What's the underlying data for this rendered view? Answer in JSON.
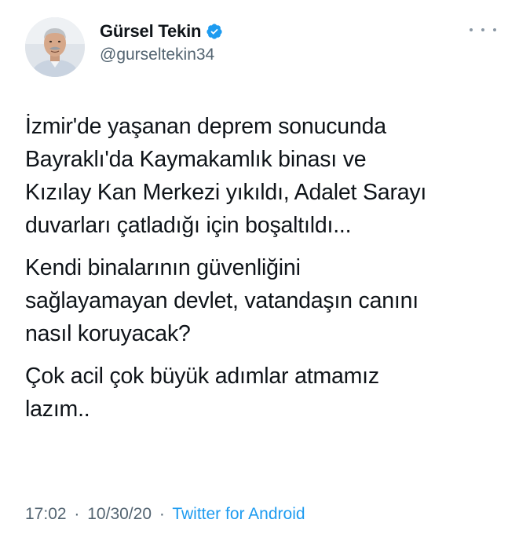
{
  "author": {
    "display_name": "Gürsel Tekin",
    "handle": "@gurseltekin34",
    "verified": true,
    "avatar": "profile-photo"
  },
  "more_menu_icon": "more-horizontal-icon",
  "tweet": {
    "paragraphs": [
      "İzmir'de yaşanan deprem sonucunda\nBayraklı'da Kaymakamlık binası ve\nKızılay Kan Merkezi yıkıldı, Adalet Sarayı\nduvarları çatladığı için boşaltıldı...",
      "Kendi binalarının güvenliğini\nsağlayamayan devlet, vatandaşın canını\nnasıl koruyacak?",
      "Çok acil çok büyük adımlar atmamız\nlazım.."
    ]
  },
  "meta": {
    "time": "17:02",
    "separator": "·",
    "date": "10/30/20",
    "source": "Twitter for Android"
  },
  "colors": {
    "text": "#0f1419",
    "secondary": "#536471",
    "accent": "#1d9bf0"
  }
}
